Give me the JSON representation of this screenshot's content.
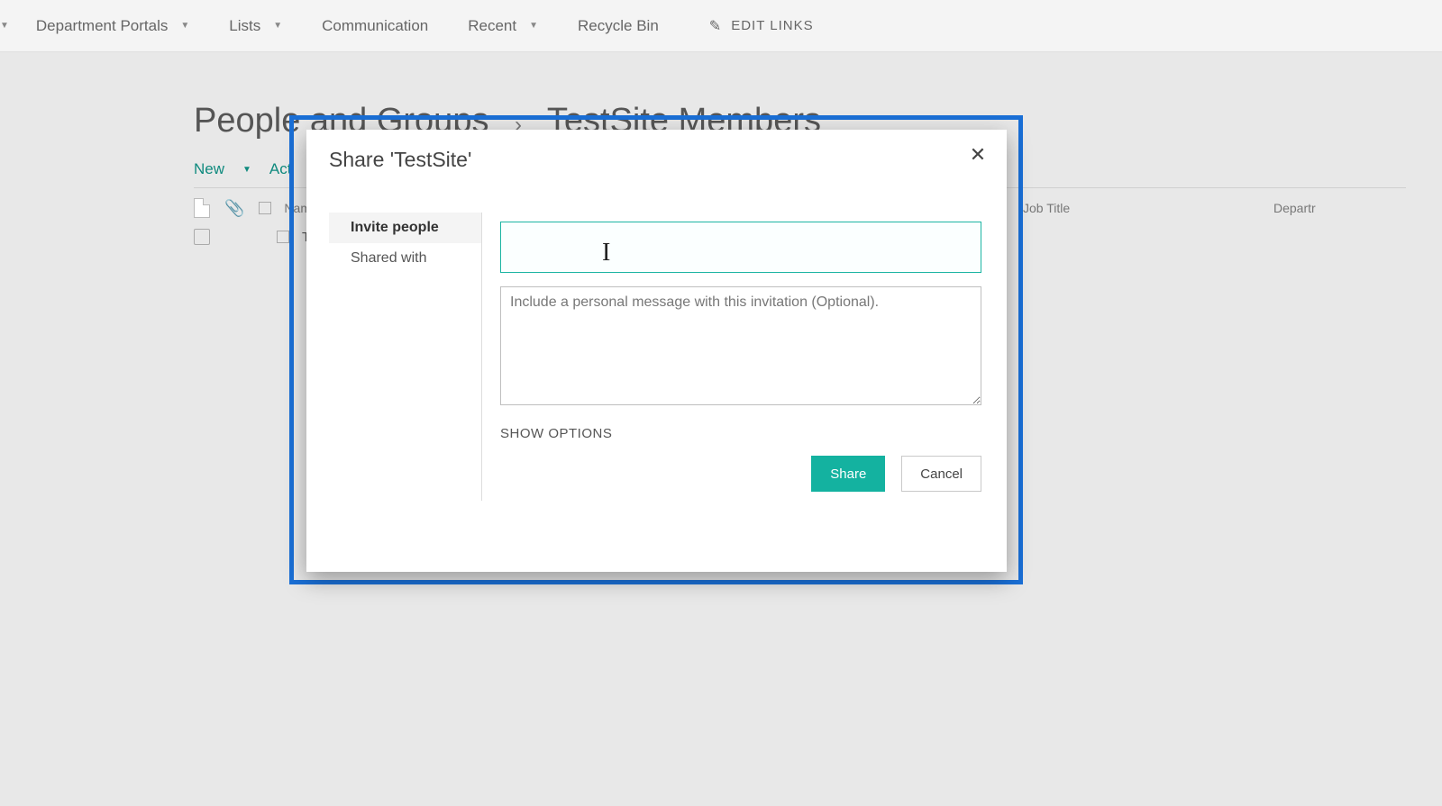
{
  "topnav": {
    "items": [
      {
        "label": "Department Portals",
        "has_caret": true
      },
      {
        "label": "Lists",
        "has_caret": true
      },
      {
        "label": "Communication",
        "has_caret": false
      },
      {
        "label": "Recent",
        "has_caret": true
      },
      {
        "label": "Recycle Bin",
        "has_caret": false
      }
    ],
    "edit_links": "EDIT LINKS"
  },
  "page": {
    "title_left": "People and Groups",
    "title_right": "TestSite Members",
    "toolbar": {
      "new": "New",
      "actions": "Act"
    },
    "columns": {
      "name": "Nam",
      "job_title": "Job Title",
      "department": "Departr"
    },
    "row1": "Test"
  },
  "modal": {
    "title": "Share 'TestSite'",
    "tabs": {
      "invite": "Invite people",
      "shared": "Shared with"
    },
    "people_value": "",
    "message_placeholder": "Include a personal message with this invitation (Optional).",
    "show_options": "SHOW OPTIONS",
    "share": "Share",
    "cancel": "Cancel"
  }
}
